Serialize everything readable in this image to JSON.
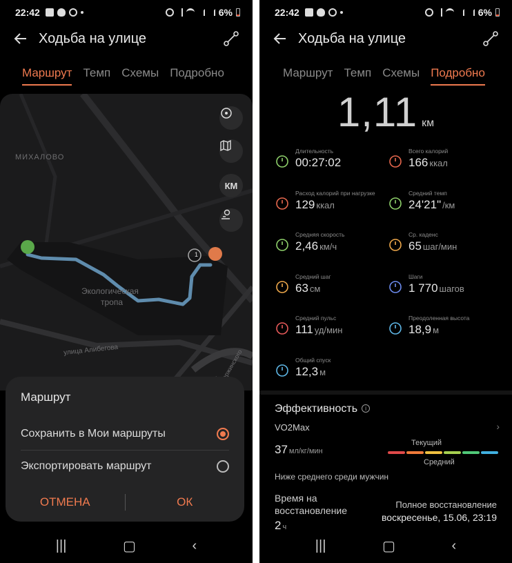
{
  "left": {
    "status": {
      "time": "22:42",
      "battery": "6%"
    },
    "header": {
      "title": "Ходьба на улице"
    },
    "tabs": [
      "Маршрут",
      "Темп",
      "Схемы",
      "Подробно"
    ],
    "active_tab": 0,
    "map": {
      "labels": [
        "МИХАЛОВО",
        "Экологическая",
        "тропа",
        "улица Алибегова",
        "кт Дзержинского"
      ],
      "km_button": "КМ",
      "marker": "1"
    },
    "dialog": {
      "title": "Маршрут",
      "option_save": "Сохранить в Мои маршруты",
      "option_export": "Экспортировать маршрут",
      "cancel": "ОТМЕНА",
      "ok": "ОК"
    }
  },
  "right": {
    "status": {
      "time": "22:42",
      "battery": "6%"
    },
    "header": {
      "title": "Ходьба на улице"
    },
    "tabs": [
      "Маршрут",
      "Темп",
      "Схемы",
      "Подробно"
    ],
    "active_tab": 3,
    "distance": {
      "value": "1,11",
      "unit": "км"
    },
    "metrics": [
      {
        "label": "Длительность",
        "value": "00:27:02",
        "unit": "",
        "color": "#8fd16b",
        "icon": "timer-icon"
      },
      {
        "label": "Всего калорий",
        "value": "166",
        "unit": "ккал",
        "color": "#e8684e",
        "icon": "calories-icon"
      },
      {
        "label": "Расход калорий при нагрузке",
        "value": "129",
        "unit": "ккал",
        "color": "#e8684e",
        "icon": "flame-icon"
      },
      {
        "label": "Средний темп",
        "value": "24'21\"",
        "unit": "/км",
        "color": "#8fd16b",
        "icon": "pace-gauge-icon"
      },
      {
        "label": "Средняя скорость",
        "value": "2,46",
        "unit": "км/ч",
        "color": "#8fd16b",
        "icon": "speed-gauge-icon"
      },
      {
        "label": "Ср. каденс",
        "value": "65",
        "unit": "шаг/мин",
        "color": "#f0a94b",
        "icon": "cadence-icon"
      },
      {
        "label": "Средний шаг",
        "value": "63",
        "unit": "см",
        "color": "#f0a94b",
        "icon": "footsteps-icon"
      },
      {
        "label": "Шаги",
        "value": "1 770",
        "unit": "шагов",
        "color": "#6d8cf0",
        "icon": "shoe-icon"
      },
      {
        "label": "Средний пульс",
        "value": "111",
        "unit": "уд/мин",
        "color": "#e85a5a",
        "icon": "heart-icon"
      },
      {
        "label": "Преодоленная высота",
        "value": "18,9",
        "unit": "м",
        "color": "#5fb8e8",
        "icon": "climb-icon"
      },
      {
        "label": "Общий спуск",
        "value": "12,3",
        "unit": "м",
        "color": "#5fb8e8",
        "icon": "descent-icon"
      }
    ],
    "efficiency": {
      "title": "Эффективность",
      "vo2_label": "VO2Max",
      "vo2_value": "37",
      "vo2_unit": "мл/кг/мин",
      "current_label": "Текущий",
      "average_label": "Средний",
      "below_text": "Ниже среднего среди мужчин",
      "recovery_label": "Время на восстановление",
      "recovery_value": "2",
      "recovery_unit": "ч",
      "full_recovery_label": "Полное восстановление",
      "full_recovery_value": "воскресенье, 15.06, 23:19",
      "scale_colors": [
        "#e04a4a",
        "#f07a3a",
        "#f0c040",
        "#a6d050",
        "#50c878",
        "#40b0e0"
      ]
    }
  }
}
